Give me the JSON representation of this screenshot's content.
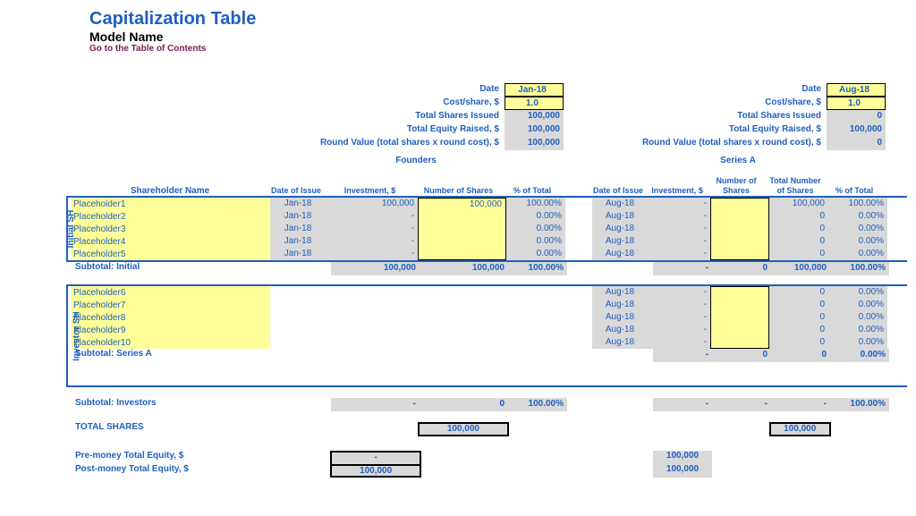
{
  "header": {
    "title": "Capitalization Table",
    "subtitle": "Model Name",
    "link": "Go to the Table of Contents"
  },
  "labels": {
    "date": "Date",
    "cost": "Cost/share, $",
    "tsi": "Total Shares Issued",
    "ter": "Total Equity Raised, $",
    "rv": "Round Value (total shares x round cost), $",
    "shn": "Shareholder Name",
    "doi": "Date of Issue",
    "inv": "Investment, $",
    "nos": "Number of Shares",
    "tnos": "Total Number of Shares",
    "pot": "% of Total",
    "founders": "Founders",
    "seriesa": "Series A",
    "subi": "Subtotal: Initial",
    "suba": "Subtotal: Series A",
    "subinv": "Subtotal: Investors",
    "totsh": "TOTAL SHARES",
    "pre": "Pre-money Total Equity, $",
    "post": "Post-money Total Equity, $",
    "ish": "Initial SH",
    "invsh": "Investor SH"
  },
  "f": {
    "date": "Jan-18",
    "cost": "1.0",
    "tsi": "100,000",
    "ter": "100,000",
    "rv": "100,000",
    "rows": [
      {
        "n": "Placeholder1",
        "d": "Jan-18",
        "i": "100,000",
        "s": "100,000",
        "p": "100.00%"
      },
      {
        "n": "Placeholder2",
        "d": "Jan-18",
        "i": "-",
        "s": "",
        "p": "0.00%"
      },
      {
        "n": "Placeholder3",
        "d": "Jan-18",
        "i": "-",
        "s": "",
        "p": "0.00%"
      },
      {
        "n": "Placeholder4",
        "d": "Jan-18",
        "i": "-",
        "s": "",
        "p": "0.00%"
      },
      {
        "n": "Placeholder5",
        "d": "Jan-18",
        "i": "-",
        "s": "",
        "p": "0.00%"
      }
    ],
    "sub": {
      "i": "100,000",
      "s": "100,000",
      "p": "100.00%"
    },
    "subinv": {
      "i": "-",
      "s": "0",
      "p": "100.00%"
    },
    "tot": "100,000",
    "pre": "-",
    "post": "100,000"
  },
  "a": {
    "date": "Aug-18",
    "cost": "1.0",
    "tsi": "0",
    "ter": "100,000",
    "rv": "0",
    "rows1": [
      {
        "d": "Aug-18",
        "i": "-",
        "s": "",
        "t": "100,000",
        "p": "100.00%"
      },
      {
        "d": "Aug-18",
        "i": "-",
        "s": "",
        "t": "0",
        "p": "0.00%"
      },
      {
        "d": "Aug-18",
        "i": "-",
        "s": "",
        "t": "0",
        "p": "0.00%"
      },
      {
        "d": "Aug-18",
        "i": "-",
        "s": "",
        "t": "0",
        "p": "0.00%"
      },
      {
        "d": "Aug-18",
        "i": "-",
        "s": "",
        "t": "0",
        "p": "0.00%"
      }
    ],
    "sub1": {
      "i": "-",
      "s": "0",
      "t": "100,000",
      "p": "100.00%"
    },
    "rows2": [
      {
        "n": "Placeholder6",
        "d": "Aug-18",
        "i": "-",
        "s": "",
        "t": "0",
        "p": "0.00%"
      },
      {
        "n": "Placeholder7",
        "d": "Aug-18",
        "i": "-",
        "s": "",
        "t": "0",
        "p": "0.00%"
      },
      {
        "n": "Placeholder8",
        "d": "Aug-18",
        "i": "-",
        "s": "",
        "t": "0",
        "p": "0.00%"
      },
      {
        "n": "Placeholder9",
        "d": "Aug-18",
        "i": "-",
        "s": "",
        "t": "0",
        "p": "0.00%"
      },
      {
        "n": "Placeholder10",
        "d": "Aug-18",
        "i": "-",
        "s": "",
        "t": "0",
        "p": "0.00%"
      }
    ],
    "sub2": {
      "i": "-",
      "s": "0",
      "t": "0",
      "p": "0.00%"
    },
    "subinv": {
      "i": "-",
      "s": "-",
      "t": "-",
      "p": "100.00%"
    },
    "tot": "100,000",
    "pre": "100,000",
    "post": "100,000"
  }
}
